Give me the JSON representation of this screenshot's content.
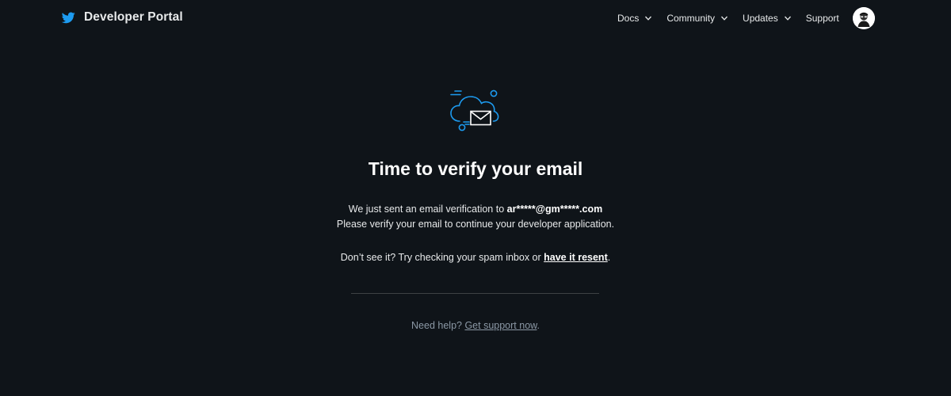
{
  "header": {
    "brand_name": "Developer Portal",
    "brand_icon": "twitter-bird-icon",
    "brand_color": "#1d9bf0",
    "nav": [
      {
        "label": "Docs",
        "has_dropdown": true
      },
      {
        "label": "Community",
        "has_dropdown": true
      },
      {
        "label": "Updates",
        "has_dropdown": true
      },
      {
        "label": "Support",
        "has_dropdown": false
      }
    ],
    "avatar_icon": "user-avatar-icon"
  },
  "main": {
    "icon": "cloud-envelope-icon",
    "title": "Time to verify your email",
    "message_line1_prefix": "We just sent an email verification to ",
    "email": "ar*****@gm*****.com",
    "message_line2": "Please verify your email to continue your developer application.",
    "spam_prefix": "Don’t see it? Try checking your spam inbox or ",
    "resend_link": "have it resent",
    "spam_suffix": ".",
    "help_prefix": "Need help? ",
    "support_link": "Get support now",
    "help_suffix": "."
  },
  "colors": {
    "background": "#0f1419",
    "accent": "#1d9bf0",
    "muted_text": "#8b98a5",
    "divider": "#3e4144"
  }
}
